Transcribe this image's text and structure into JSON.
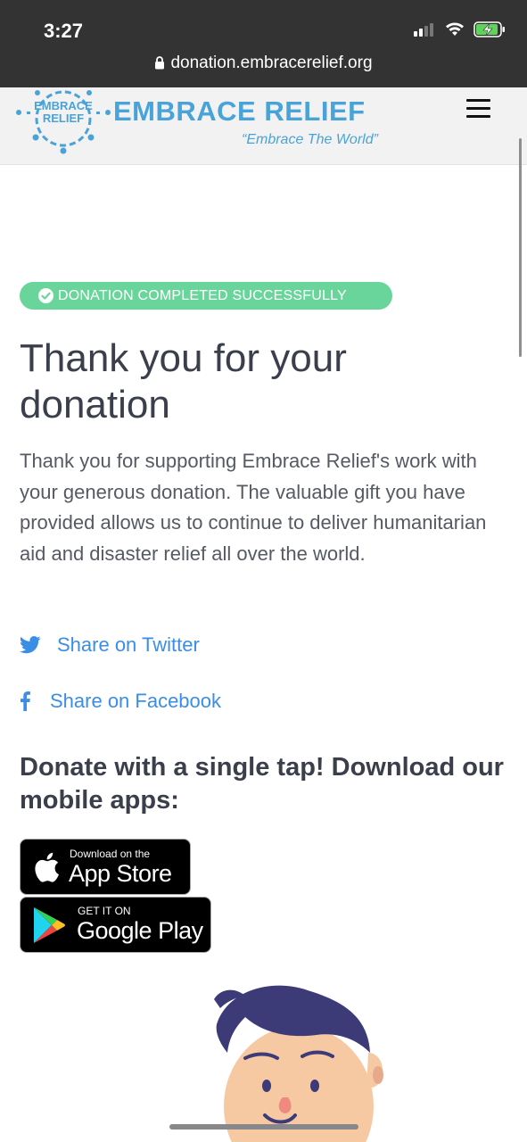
{
  "status_bar": {
    "time": "3:27",
    "url": "donation.embracerelief.org",
    "icons": [
      "signal-icon",
      "wifi-icon",
      "battery-charging-icon"
    ]
  },
  "header": {
    "logo_text_top": "EMBRACE",
    "logo_text_bottom": "RELIEF",
    "brand": "EMBRACE RELIEF",
    "tagline": "“Embrace The World”",
    "menu_icon": "hamburger-icon"
  },
  "main": {
    "badge": "DONATION COMPLETED SUCCESSFULLY",
    "title": "Thank you for your donation",
    "body": "Thank you for supporting Embrace Relief's work with your generous donation. The valuable gift you have provided allows us to continue to deliver humanitarian aid and disaster relief all over the world.",
    "share_twitter": "Share on Twitter",
    "share_facebook": "Share on Facebook",
    "apps_heading": "Donate with a single tap! Download our mobile apps:",
    "app_store": {
      "small": "Download on the",
      "big": "App Store"
    },
    "google_play": {
      "small": "GET IT ON",
      "big": "Google Play"
    }
  },
  "colors": {
    "status_bar": "#333333",
    "brand": "#4aa3d8",
    "badge": "#6ad59a",
    "link": "#3a8ee6",
    "heading": "#3b3f4c"
  }
}
